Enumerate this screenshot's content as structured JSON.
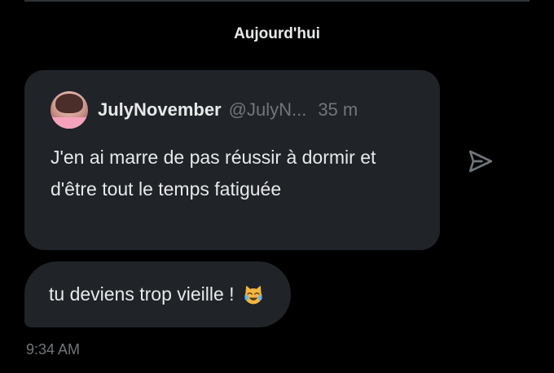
{
  "date_separator": "Aujourd'hui",
  "quoted_post": {
    "author_name": "JulyNovember",
    "author_handle": "@JulyN...",
    "time_ago": "35 m",
    "text": "J'en ai marre de pas réussir à dormir et d'être tout le temps fatiguée",
    "avatar_icon": "profile-avatar"
  },
  "share_icon": "send-icon",
  "message": {
    "text": "tu deviens trop vieille !",
    "emoji": "cat-tears-of-joy",
    "timestamp": "9:34 AM"
  },
  "colors": {
    "background": "#000000",
    "bubble": "#202327",
    "primary_text": "#e7e9ea",
    "secondary_text": "#71767b"
  }
}
